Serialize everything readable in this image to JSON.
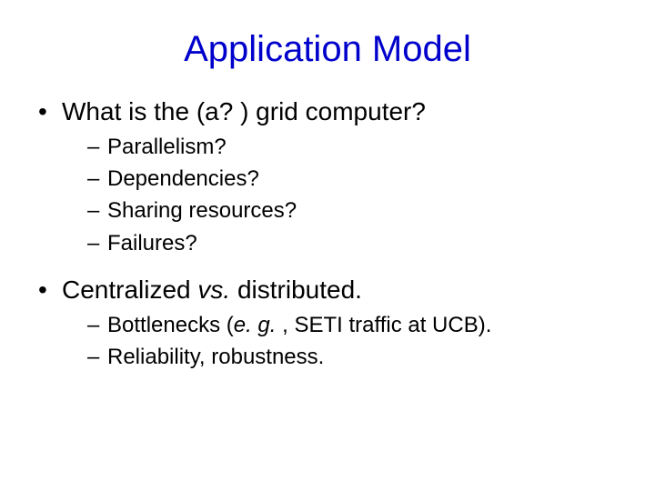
{
  "title": "Application Model",
  "bullets": {
    "b1": {
      "text": "What is the (a? ) grid computer?",
      "subs": [
        "Parallelism?",
        "Dependencies?",
        "Sharing resources?",
        "Failures?"
      ]
    },
    "b2": {
      "pre": "Centralized ",
      "ital": "vs.",
      "post": " distributed.",
      "sub1_pre": "Bottlenecks (",
      "sub1_ital": "e. g.",
      "sub1_post": " , SETI traffic at UCB).",
      "sub2": "Reliability, robustness."
    }
  }
}
